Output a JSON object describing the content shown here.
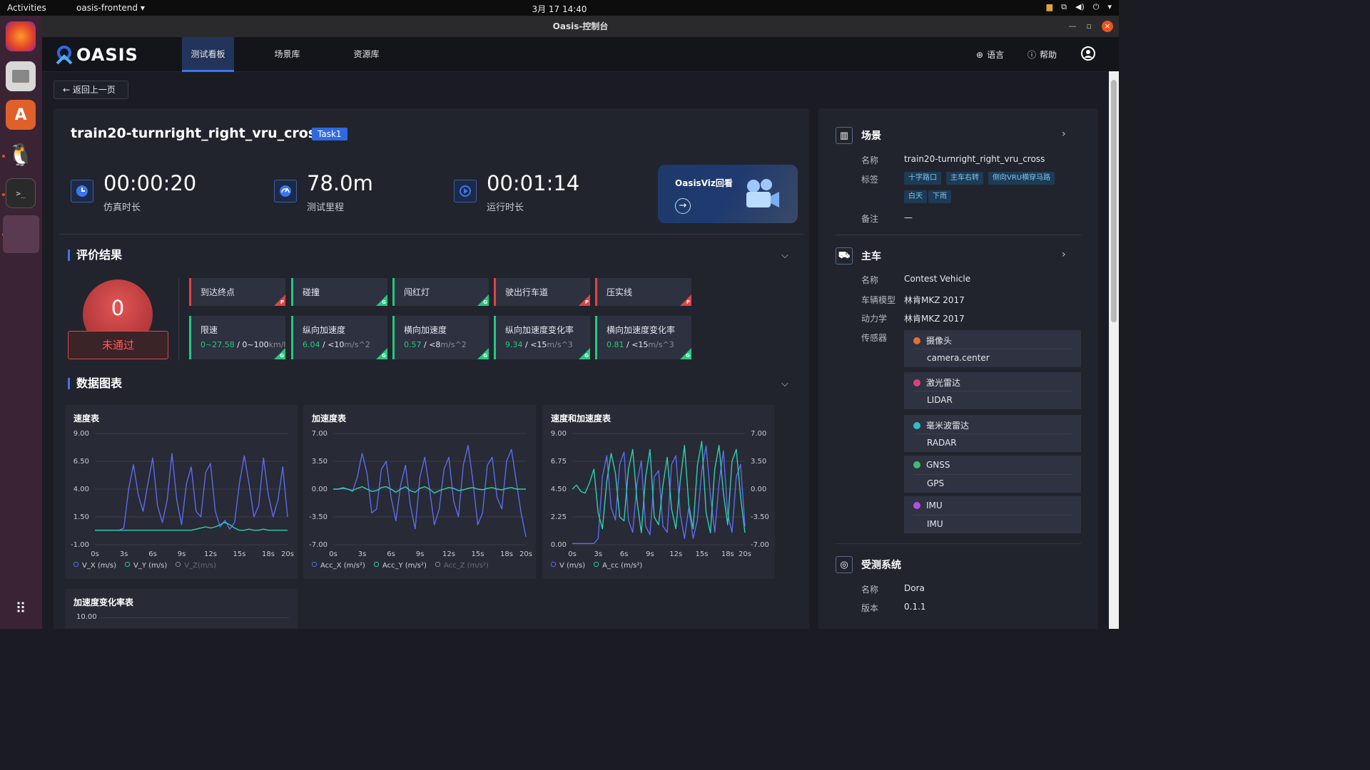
{
  "os": {
    "activities": "Activities",
    "app_name": "oasis-frontend",
    "clock": "3月 17  14:40",
    "tray_icons": [
      "keyboard-icon",
      "network-icon",
      "volume-icon",
      "power-icon",
      "chevron-down-icon"
    ]
  },
  "window": {
    "title": "Oasis-控制台"
  },
  "nav": {
    "logo": "OASIS",
    "tabs": [
      "测试看板",
      "场景库",
      "资源库"
    ],
    "active_tab": 0,
    "language": "语言",
    "help": "帮助"
  },
  "back_label": "返回上一页",
  "test": {
    "title": "train20-turnright_right_vru_cross",
    "task_badge": "Task1",
    "stats": [
      {
        "value": "00:00:20",
        "label": "仿真时长",
        "icon": "clock-icon"
      },
      {
        "value": "78.0m",
        "label": "测试里程",
        "icon": "speedometer-icon"
      },
      {
        "value": "00:01:14",
        "label": "运行时长",
        "icon": "run-icon"
      }
    ],
    "viz_label": "OasisViz回看"
  },
  "evaluation": {
    "title": "评价结果",
    "score": "0",
    "result": "未通过",
    "checks": [
      {
        "name": "到达终点",
        "flag": "P",
        "status": "fail"
      },
      {
        "name": "碰撞",
        "flag": "G",
        "status": "pass"
      },
      {
        "name": "闯红灯",
        "flag": "G",
        "status": "pass"
      },
      {
        "name": "驶出行车道",
        "flag": "P",
        "status": "fail"
      },
      {
        "name": "压实线",
        "flag": "P",
        "status": "fail"
      }
    ],
    "metrics": [
      {
        "name": "限速",
        "value": "0~27.58",
        "limit": "0~100",
        "unit": "km/h",
        "flag": "G"
      },
      {
        "name": "纵向加速度",
        "value": "6.04",
        "limit": "<10",
        "unit": "m/s^2",
        "flag": "G"
      },
      {
        "name": "横向加速度",
        "value": "0.57",
        "limit": "<8",
        "unit": "m/s^2",
        "flag": "G"
      },
      {
        "name": "纵向加速度变化率",
        "value": "9.34",
        "limit": "<15",
        "unit": "m/s^3",
        "flag": "G"
      },
      {
        "name": "横向加速度变化率",
        "value": "0.81",
        "limit": "<15",
        "unit": "m/s^3",
        "flag": "G"
      }
    ]
  },
  "charts_section": {
    "title": "数据图表"
  },
  "chart_data": [
    {
      "type": "line",
      "title": "速度表",
      "x": [
        "0s",
        "3s",
        "6s",
        "9s",
        "12s",
        "15s",
        "18s",
        "20s"
      ],
      "ylim": [
        -1.0,
        9.0
      ],
      "y_ticks": [
        "9.00",
        "6.50",
        "4.00",
        "1.50",
        "-1.00"
      ],
      "series": [
        {
          "name": "V_X (m/s)",
          "color": "#5b6cf0",
          "values": [
            0.3,
            0.3,
            0.3,
            0.3,
            0.3,
            0.3,
            0.5,
            4.0,
            6.2,
            3.5,
            2.0,
            4.5,
            6.8,
            2.5,
            1.0,
            3.0,
            7.2,
            3.0,
            0.8,
            4.5,
            6.0,
            2.0,
            1.5,
            5.5,
            6.3,
            2.0,
            0.6,
            1.2,
            0.4,
            1.0,
            4.5,
            7.0,
            4.5,
            1.5,
            2.5,
            6.8,
            3.5,
            1.5,
            3.0,
            6.0,
            1.5
          ]
        },
        {
          "name": "V_Y (m/s)",
          "color": "#2ecfb2",
          "values": [
            0.3,
            0.3,
            0.3,
            0.3,
            0.3,
            0.3,
            0.3,
            0.3,
            0.3,
            0.3,
            0.3,
            0.3,
            0.3,
            0.3,
            0.3,
            0.3,
            0.3,
            0.3,
            0.3,
            0.3,
            0.3,
            0.4,
            0.5,
            0.6,
            0.5,
            0.6,
            0.8,
            1.0,
            0.8,
            0.5,
            0.3,
            0.3,
            0.4,
            0.3,
            0.3,
            0.4,
            0.3,
            0.3,
            0.3,
            0.3,
            0.3
          ]
        },
        {
          "name": "V_Z(m/s)",
          "color": "#8a8d98",
          "values": []
        }
      ]
    },
    {
      "type": "line",
      "title": "加速度表",
      "x": [
        "0s",
        "3s",
        "6s",
        "9s",
        "12s",
        "15s",
        "18s",
        "20s"
      ],
      "ylim": [
        -7.0,
        7.0
      ],
      "y_ticks": [
        "7.00",
        "3.50",
        "0.00",
        "-3.50",
        "-7.00"
      ],
      "series": [
        {
          "name": "Acc_X (m/s²)",
          "color": "#5b6cf0",
          "values": [
            0.0,
            0.0,
            0.2,
            0.0,
            -0.3,
            1.5,
            4.5,
            2.0,
            -3.0,
            -2.5,
            2.5,
            3.5,
            -1.0,
            -4.0,
            0.5,
            3.0,
            -2.0,
            -5.0,
            1.5,
            4.0,
            0.0,
            -4.5,
            -2.5,
            2.5,
            4.0,
            -1.5,
            -3.5,
            3.0,
            5.5,
            1.0,
            -4.5,
            -3.0,
            3.0,
            4.0,
            -1.0,
            -2.5,
            3.5,
            5.0,
            1.0,
            -3.0,
            -6.0
          ]
        },
        {
          "name": "Acc_Y (m/s²)",
          "color": "#2ecfb2",
          "values": [
            0.0,
            0.0,
            0.1,
            0.0,
            -0.2,
            0.1,
            0.3,
            0.0,
            -0.3,
            -0.2,
            0.2,
            0.3,
            0.0,
            -0.4,
            0.0,
            0.3,
            -0.2,
            -0.4,
            0.1,
            0.3,
            0.0,
            -0.5,
            -0.2,
            0.0,
            0.2,
            0.1,
            -0.2,
            -0.1,
            0.1,
            0.2,
            0.0,
            -0.1,
            0.1,
            0.2,
            0.0,
            -0.1,
            0.1,
            0.2,
            0.0,
            0.0,
            0.0
          ]
        },
        {
          "name": "Acc_Z (m/s²)",
          "color": "#8a8d98",
          "values": []
        }
      ]
    },
    {
      "type": "line",
      "title": "速度和加速度表",
      "x": [
        "0s",
        "3s",
        "6s",
        "9s",
        "12s",
        "15s",
        "18s",
        "20s"
      ],
      "ylim": [
        0.0,
        9.0
      ],
      "y_ticks": [
        "9.00",
        "6.75",
        "4.50",
        "2.25",
        "0.00"
      ],
      "y2lim": [
        -7.0,
        7.0
      ],
      "y2_ticks": [
        "7.00",
        "3.50",
        "0.00",
        "-3.50",
        "-7.00"
      ],
      "series": [
        {
          "name": "V (m/s)",
          "color": "#5b6cf0",
          "values": [
            0.1,
            0.1,
            0.1,
            0.1,
            0.1,
            0.1,
            0.5,
            5.5,
            7.2,
            3.0,
            2.0,
            6.5,
            7.5,
            2.0,
            1.0,
            5.0,
            6.8,
            1.5,
            0.8,
            5.5,
            6.0,
            1.5,
            1.0,
            6.5,
            7.2,
            2.5,
            0.5,
            3.0,
            0.5,
            2.0,
            6.0,
            8.0,
            4.0,
            1.0,
            5.0,
            7.6,
            2.5,
            1.0,
            5.5,
            6.5,
            1.5
          ]
        },
        {
          "name": "A_cc (m/s²)",
          "color": "#2ecfb2",
          "values": [
            0.0,
            0.5,
            -0.3,
            -0.5,
            0.8,
            2.5,
            -3.0,
            -5.0,
            1.0,
            4.5,
            2.0,
            -3.5,
            -4.0,
            2.5,
            5.0,
            -1.5,
            -5.5,
            1.5,
            5.0,
            -3.5,
            -4.5,
            0.5,
            4.0,
            -2.5,
            -5.0,
            1.0,
            5.5,
            -2.0,
            -5.0,
            3.0,
            6.0,
            -3.0,
            -5.5,
            2.5,
            5.5,
            -0.5,
            -4.5,
            3.5,
            5.0,
            -1.0,
            -5.5
          ]
        }
      ]
    },
    {
      "type": "line",
      "title": "加速度变化率表",
      "x": [],
      "y_ticks": [
        "10.00"
      ],
      "series": []
    }
  ],
  "scene": {
    "title": "场景",
    "name_label": "名称",
    "name": "train20-turnright_right_vru_cross",
    "tags_label": "标签",
    "tags": [
      "十字路口",
      "主车右转",
      "侧向VRU横穿马路",
      "白天",
      "下雨"
    ],
    "note_label": "备注",
    "note": "—"
  },
  "vehicle": {
    "title": "主车",
    "name_label": "名称",
    "name": "Contest Vehicle",
    "model_label": "车辆模型",
    "model": "林肯MKZ 2017",
    "dyn_label": "动力学",
    "dyn": "林肯MKZ 2017",
    "sensor_label": "传感器",
    "sensors": [
      {
        "type": "摄像头",
        "id": "camera.center",
        "color": "#e0703a"
      },
      {
        "type": "激光雷达",
        "id": "LIDAR",
        "color": "#e0407a"
      },
      {
        "type": "毫米波雷达",
        "id": "RADAR",
        "color": "#2ec0c0"
      },
      {
        "type": "GNSS",
        "id": "GPS",
        "color": "#3ac070"
      },
      {
        "type": "IMU",
        "id": "IMU",
        "color": "#b050e0"
      }
    ]
  },
  "sut": {
    "title": "受测系统",
    "name_label": "名称",
    "name": "Dora",
    "version_label": "版本",
    "version": "0.1.1"
  }
}
